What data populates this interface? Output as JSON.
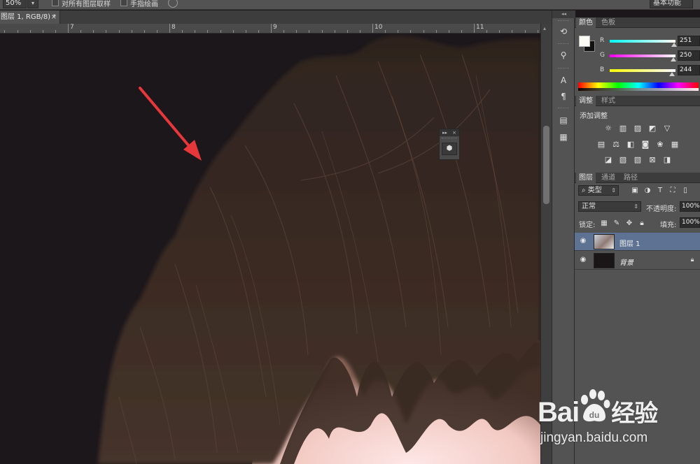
{
  "options_bar": {
    "zoom_value": "50%",
    "sample_all_layers_label": "对所有图层取样",
    "finger_paint_label": "手指绘画",
    "workspace_label": "基本功能"
  },
  "document_tab": {
    "title": "图层 1, RGB/8) *",
    "close": "×"
  },
  "ruler": {
    "labels": [
      "7",
      "8",
      "9",
      "10",
      "11"
    ]
  },
  "float_panel": {
    "expand": "▸▸",
    "close": "×"
  },
  "color_panel": {
    "tabs": [
      "颜色",
      "色板"
    ],
    "r_label": "R",
    "g_label": "G",
    "b_label": "B",
    "r_value": "251",
    "g_value": "250",
    "b_value": "244",
    "foreground": "#fbfaf4",
    "background": "#111111"
  },
  "adjustments_panel": {
    "tabs": [
      "调整",
      "样式"
    ],
    "title": "添加调整"
  },
  "layers_panel": {
    "tabs": [
      "图层",
      "通道",
      "路径"
    ],
    "filter_kind": "类型",
    "blend_mode": "正常",
    "opacity_label": "不透明度:",
    "opacity_value": "100%",
    "lock_label": "锁定:",
    "fill_label": "填充:",
    "fill_value": "100%",
    "layers": [
      {
        "name": "图层 1",
        "selected": true
      },
      {
        "name": "背景",
        "selected": false,
        "locked": true
      }
    ]
  },
  "watermark": {
    "brand": "Bai",
    "brand_suffix": "经验",
    "url": "jingyan.baidu.com"
  }
}
